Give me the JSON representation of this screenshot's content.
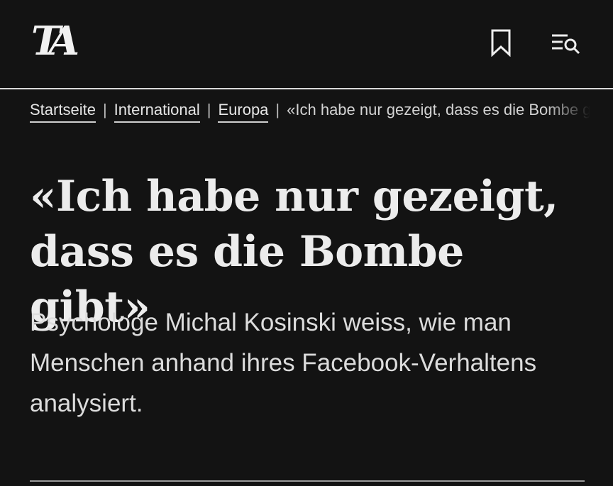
{
  "header": {
    "logo_text": "TA",
    "bookmark_icon": "bookmark-icon",
    "menu_search_icon": "menu-search-icon"
  },
  "breadcrumb": {
    "items": [
      {
        "label": "Startseite"
      },
      {
        "label": "International"
      },
      {
        "label": "Europa"
      }
    ],
    "current": "«Ich habe nur gezeigt, dass es die Bombe gibt»"
  },
  "article": {
    "headline": "«Ich habe nur gezeigt, dass es die Bombe gibt»",
    "lead": "Psychologe Michal Kosinski weiss, wie man Menschen anhand ihres Facebook-Verhaltens analysiert."
  },
  "colors": {
    "background": "#131313",
    "text": "#e9e9e9",
    "rule": "#d9d9d9"
  }
}
